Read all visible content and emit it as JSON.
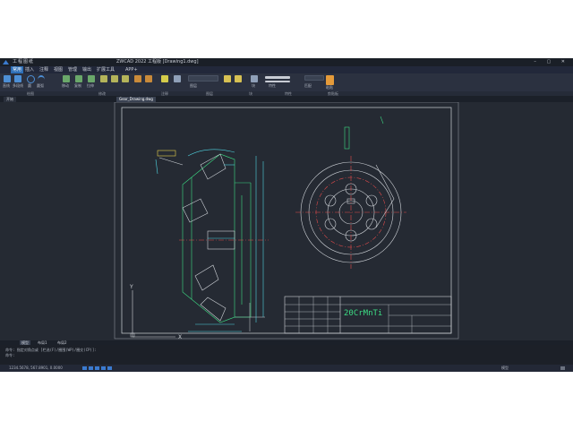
{
  "window": {
    "title": "ZWCAD 2022 工程版 [Drawing1.dwg]",
    "qat": "工程图纸",
    "controls": "– ▢ ✕"
  },
  "menu": {
    "items": [
      "常用",
      "插入",
      "注释",
      "视图",
      "管理",
      "输出",
      "扩展工具",
      "APP+"
    ],
    "active_index": 0
  },
  "ribbon": {
    "labels": [
      "直线",
      "多段线",
      "圆",
      "圆弧",
      "移动",
      "复制",
      "拉伸",
      "图层",
      "特性",
      "匹配",
      "块",
      "粘贴"
    ],
    "groups": [
      "绘图",
      "修改",
      "注释",
      "图层",
      "块",
      "特性",
      "剪贴板"
    ]
  },
  "tabs": [
    {
      "label": "开始"
    },
    {
      "label": "Gear_Drawing.dwg"
    }
  ],
  "layout_tabs": [
    "模型",
    "布局1",
    "布局2"
  ],
  "command": {
    "line1": "命令: 指定对角点或 [栏选(F)/圈围(WP)/圈交(CP)]:",
    "line2": "命令:"
  },
  "status": {
    "coords": "1234.5678, 567.8901, 0.0000",
    "mode": "模型"
  },
  "drawing": {
    "title_block_text": "20CrMnTi",
    "axis_x": "X",
    "axis_y": "Y"
  },
  "colors": {
    "bg": "#252a33",
    "border": "#cfd3d8",
    "geom": "#3ddc84",
    "center": "#e14b4b",
    "yellow": "#e8d34a",
    "cyan": "#4fd3e0"
  }
}
